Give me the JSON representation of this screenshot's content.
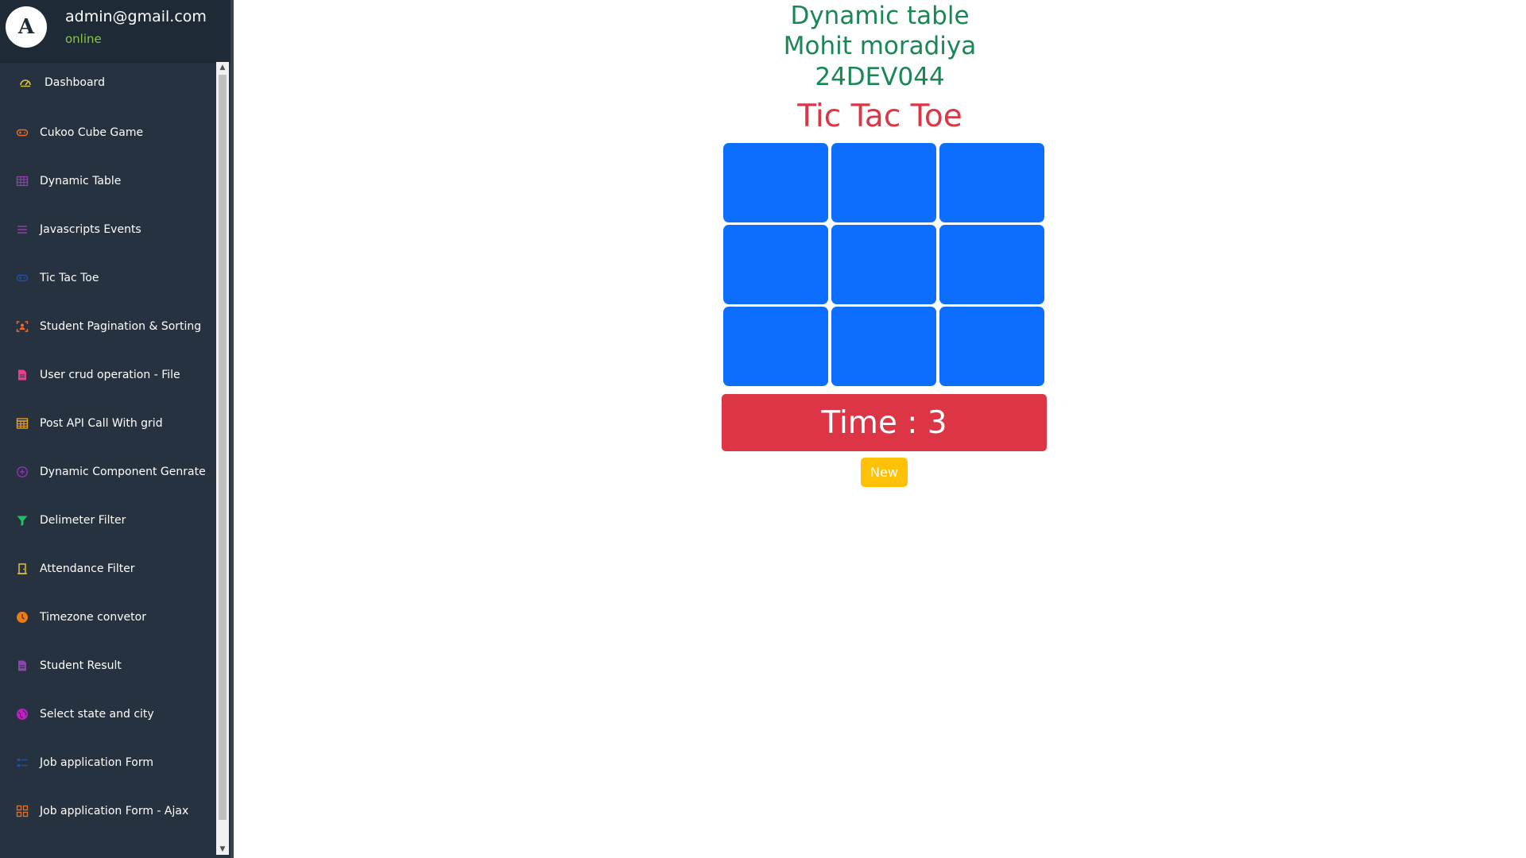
{
  "profile": {
    "avatar_letter": "A",
    "email": "admin@gmail.com",
    "status": "online"
  },
  "sidebar": {
    "items": [
      {
        "label": "Dashboard",
        "icon": "gauge-icon",
        "color": "#e0c040"
      },
      {
        "label": "Cukoo Cube Game",
        "icon": "gamepad-icon",
        "color": "#e8702a"
      },
      {
        "label": "Dynamic Table",
        "icon": "table-icon",
        "color": "#8e44ad"
      },
      {
        "label": "Javascripts Events",
        "icon": "list-icon",
        "color": "#8e44ad"
      },
      {
        "label": "Tic Tac Toe",
        "icon": "gamepad-icon",
        "color": "#1f4fa8"
      },
      {
        "label": "Student Pagination & Sorting",
        "icon": "user-card-icon",
        "color": "#e8702a"
      },
      {
        "label": "User crud operation - File",
        "icon": "file-icon",
        "color": "#e83e8c"
      },
      {
        "label": "Post API Call With grid",
        "icon": "grid-icon",
        "color": "#f0a020"
      },
      {
        "label": "Dynamic Component Genrate",
        "icon": "plus-circle-icon",
        "color": "#9b30c0"
      },
      {
        "label": "Delimeter Filter",
        "icon": "filter-icon",
        "color": "#20c060"
      },
      {
        "label": "Attendance Filter",
        "icon": "door-icon",
        "color": "#e0c040"
      },
      {
        "label": "Timezone convetor",
        "icon": "clock-icon",
        "color": "#f07a10"
      },
      {
        "label": "Student Result",
        "icon": "document-icon",
        "color": "#8e44ad"
      },
      {
        "label": "Select state and city",
        "icon": "globe-icon",
        "color": "#c020c0"
      },
      {
        "label": "Job application Form",
        "icon": "form-icon",
        "color": "#1f4fa8"
      },
      {
        "label": "Job application Form - Ajax",
        "icon": "apps-icon",
        "color": "#e8702a"
      }
    ]
  },
  "main": {
    "heading_lines": [
      "Dynamic table",
      "Mohit moradiya",
      "24DEV044"
    ],
    "game_title": "Tic Tac Toe",
    "board": {
      "cells": [
        "",
        "",
        "",
        "",
        "",
        "",
        "",
        "",
        ""
      ]
    },
    "timer_text": "Time : 3",
    "new_button_label": "New"
  },
  "colors": {
    "sidebar_bg": "#263240",
    "heading_green": "#198754",
    "title_red": "#dc3545",
    "cell_blue": "#0d6efd",
    "button_yellow": "#ffc107"
  }
}
